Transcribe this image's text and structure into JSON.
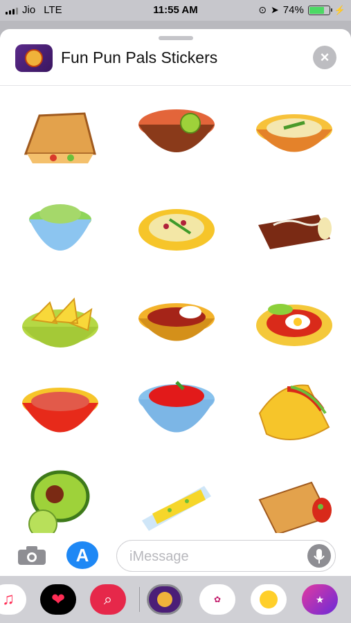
{
  "status": {
    "carrier": "Jio",
    "network": "LTE",
    "time": "11:55 AM",
    "battery": "74%"
  },
  "header": {
    "title": "Fun Pun Pals Stickers",
    "close_icon": "close-icon",
    "app_icon": "fun-pun-pals-icon"
  },
  "stickers": [
    {
      "name": "quesadilla"
    },
    {
      "name": "tortilla-soup-with-lime"
    },
    {
      "name": "rice-bowl-with-peppers"
    },
    {
      "name": "guacamole-bowl"
    },
    {
      "name": "bean-salad-plate"
    },
    {
      "name": "chocolate-enchilada"
    },
    {
      "name": "tortilla-chips-bowl"
    },
    {
      "name": "chili-bowl-with-sour-cream"
    },
    {
      "name": "huevos-rancheros"
    },
    {
      "name": "pozole-bowl"
    },
    {
      "name": "salsa-bowl"
    },
    {
      "name": "taco"
    },
    {
      "name": "avocado-and-lime"
    },
    {
      "name": "elote-corn"
    },
    {
      "name": "burrito"
    }
  ],
  "compose": {
    "placeholder": "iMessage",
    "camera_icon": "camera-icon",
    "appstore_icon": "app-store-icon",
    "mic_icon": "microphone-icon"
  },
  "dock": [
    {
      "name": "music-app"
    },
    {
      "name": "digital-touch-app"
    },
    {
      "name": "image-search-app"
    },
    {
      "name": "fun-pun-pals-app"
    },
    {
      "name": "beautiful-day-stickers-app"
    },
    {
      "name": "3d-emoji-stickers-app"
    },
    {
      "name": "cool-dude-stickers-app"
    }
  ]
}
